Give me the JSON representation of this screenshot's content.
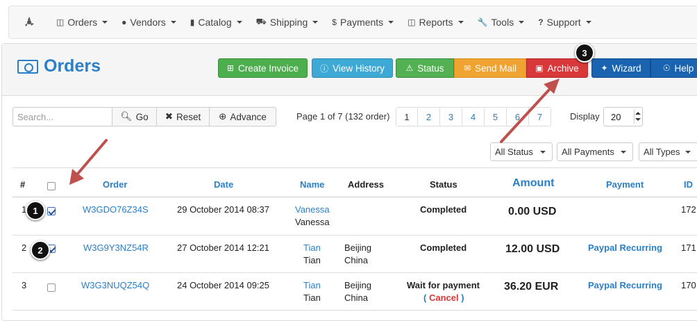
{
  "nav": {
    "items": [
      {
        "label": "Orders",
        "icon": "money-icon"
      },
      {
        "label": "Vendors",
        "icon": "user-icon"
      },
      {
        "label": "Catalog",
        "icon": "bookmark-icon"
      },
      {
        "label": "Shipping",
        "icon": "truck-icon"
      },
      {
        "label": "Payments",
        "icon": "dollar-icon"
      },
      {
        "label": "Reports",
        "icon": "money-icon"
      },
      {
        "label": "Tools",
        "icon": "wrench-icon"
      },
      {
        "label": "Support",
        "icon": "question-icon"
      }
    ]
  },
  "page": {
    "title": "Orders"
  },
  "actions": {
    "create_invoice": "Create Invoice",
    "view_history": "View History",
    "status": "Status",
    "send_mail": "Send Mail",
    "archive": "Archive",
    "wizard": "Wizard",
    "help": "Help"
  },
  "toolbar": {
    "search_placeholder": "Search...",
    "go": "Go",
    "reset": "Reset",
    "advance": "Advance",
    "page_info": "Page 1 of 7 (132 order)",
    "pages": [
      "1",
      "2",
      "3",
      "4",
      "5",
      "6",
      "7"
    ],
    "display_label": "Display",
    "display_value": "20"
  },
  "filters": {
    "status": "All Status",
    "payments": "All Payments",
    "types": "All Types"
  },
  "table": {
    "headers": {
      "num": "#",
      "order": "Order",
      "date": "Date",
      "name": "Name",
      "address": "Address",
      "status": "Status",
      "amount": "Amount",
      "payment": "Payment",
      "id": "ID"
    },
    "rows": [
      {
        "num": "1",
        "order": "W3GDO76Z34S",
        "date": "29 October 2014 08:37",
        "name1": "Vanessa",
        "name2": "Vanessa",
        "addr1": "",
        "addr2": "",
        "status": "Completed",
        "amount": "0.00 USD",
        "payment": "",
        "id": "172",
        "checked": true
      },
      {
        "num": "2",
        "order": "W3G9Y3NZ54R",
        "date": "27 October 2014 12:21",
        "name1": "Tian",
        "name2": "Tian",
        "addr1": "Beijing",
        "addr2": "China",
        "status": "Completed",
        "amount": "12.00 USD",
        "payment": "Paypal Recurring",
        "id": "171",
        "checked": true
      },
      {
        "num": "3",
        "order": "W3G3NUQZ54Q",
        "date": "24 October 2014 09:25",
        "name1": "Tian",
        "name2": "Tian",
        "addr1": "Beijing",
        "addr2": "China",
        "status": "Wait for payment",
        "cancel": "Cancel",
        "amount": "36.20 EUR",
        "payment": "Paypal Recurring",
        "id": "170",
        "checked": false
      }
    ]
  },
  "callouts": [
    "1",
    "2",
    "3"
  ],
  "colors": {
    "accent": "#2a7fc9",
    "arrow": "#c0504d"
  }
}
